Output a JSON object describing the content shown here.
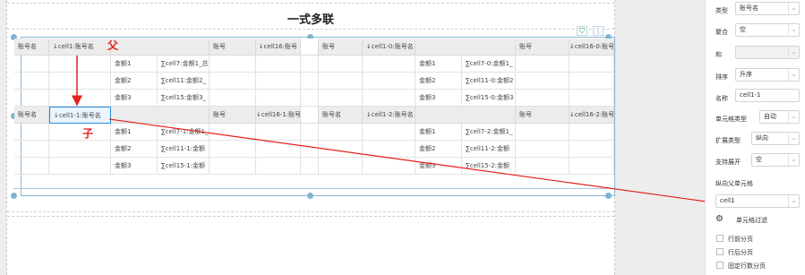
{
  "report": {
    "title": "一式多联",
    "toolbar": {
      "filter_icon": "filter-icon",
      "more_icon": "more-icon"
    }
  },
  "grid": {
    "block1": {
      "header": [
        "账号名",
        "↓cell1:账号名",
        "账号",
        "↓cell16:账号",
        "账号",
        "↓cell1-0:账号名",
        "账号",
        "↓cell16-0:账号"
      ],
      "rows": [
        {
          "left_label": "金额1",
          "left_value": "∑cell7:金额1_总",
          "right_label": "金额1",
          "right_value": "∑cell7-0:金额1_"
        },
        {
          "left_label": "金额2",
          "left_value": "∑cell11:金额2_",
          "right_label": "金额2",
          "right_value": "∑cell11-0:金额2"
        },
        {
          "left_label": "金额3",
          "left_value": "∑cell15:金额3_",
          "right_label": "金额3",
          "right_value": "∑cell15-0:金额3"
        }
      ]
    },
    "block2": {
      "header": [
        "账号名",
        "↓cell1-1:账号名",
        "账号",
        "↓cell16-1:账号",
        "账号名",
        "↓cell1-2:账号名",
        "账号",
        "↓cell16-2:账号"
      ],
      "rows": [
        {
          "left_label": "金额1",
          "left_value": "∑cell7-1:金额1_",
          "right_label": "金额1",
          "right_value": "∑cell7-2:金额1_"
        },
        {
          "left_label": "金额2",
          "left_value": "∑cell11-1:金额",
          "right_label": "金额2",
          "right_value": "∑cell11-2:金额"
        },
        {
          "left_label": "金额3",
          "left_value": "∑cell15-1:金额",
          "right_label": "金额3",
          "right_value": "∑cell15-2:金额"
        }
      ]
    }
  },
  "annotations": {
    "parent": "父",
    "child": "子",
    "color": "#e3211d"
  },
  "panel": {
    "type_label": "类型",
    "type_value": "账号名",
    "aggregate_label": "聚合",
    "aggregate_value": "空",
    "and_label": "和",
    "and_value": "",
    "sort_label": "排序",
    "sort_value": "升序",
    "name_label": "名称",
    "name_value": "cell1-1",
    "cell_type_label": "单元格类型",
    "cell_type_value": "自动",
    "expand_type_label": "扩展类型",
    "expand_type_value": "纵向",
    "support_expand_label": "支持展开",
    "support_expand_value": "空",
    "parent_cell_label": "纵向父单元格",
    "parent_cell_value": "cell1",
    "filter_label": "单元格过滤",
    "checks": [
      "行前分页",
      "行后分页",
      "固定行数分页"
    ]
  },
  "colors": {
    "selection": "#2a8cdc",
    "frame": "#8ab6d2",
    "header_bg": "#ececec"
  }
}
